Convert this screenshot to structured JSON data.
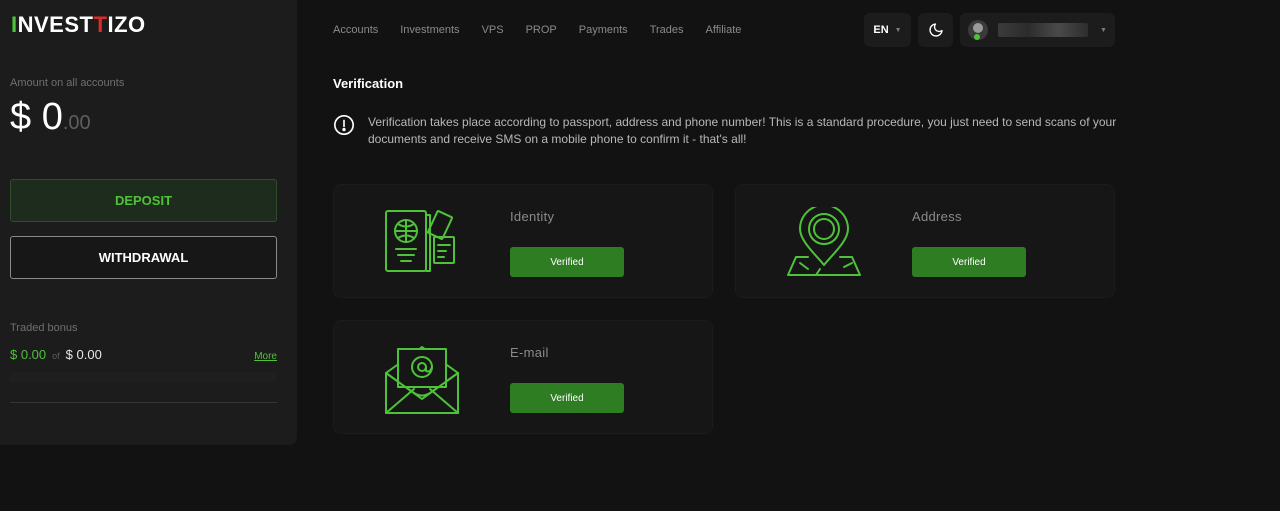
{
  "brand": {
    "logo_first": "I",
    "logo_mid": "NVEST",
    "logo_t": "I",
    "logo_end": "ZO",
    "accent": "#4ec33a"
  },
  "sidebar": {
    "amount_label": "Amount on all accounts",
    "amount_main": "$ 0",
    "amount_cents": ".00",
    "deposit_label": "DEPOSIT",
    "withdrawal_label": "WITHDRAWAL",
    "bonus_label": "Traded bonus",
    "bonus_value": "$ 0.00",
    "bonus_of": "of",
    "bonus_total": "$ 0.00",
    "bonus_more": "More",
    "bonus_progress_percent": 0
  },
  "nav": {
    "items": [
      "Accounts",
      "Investments",
      "VPS",
      "PROP",
      "Payments",
      "Trades",
      "Affiliate"
    ],
    "language": "EN",
    "theme_icon": "moon-icon"
  },
  "main": {
    "title": "Verification",
    "notice": "Verification takes place according to passport, address and phone number! This is a standard procedure, you just need to send scans of your documents and receive SMS on a mobile phone to confirm it - that's all!",
    "cards": [
      {
        "title": "Identity",
        "button": "Verified",
        "icon": "passport-icon"
      },
      {
        "title": "Address",
        "button": "Verified",
        "icon": "map-pin-icon"
      },
      {
        "title": "E-mail",
        "button": "Verified",
        "icon": "envelope-icon"
      }
    ]
  }
}
